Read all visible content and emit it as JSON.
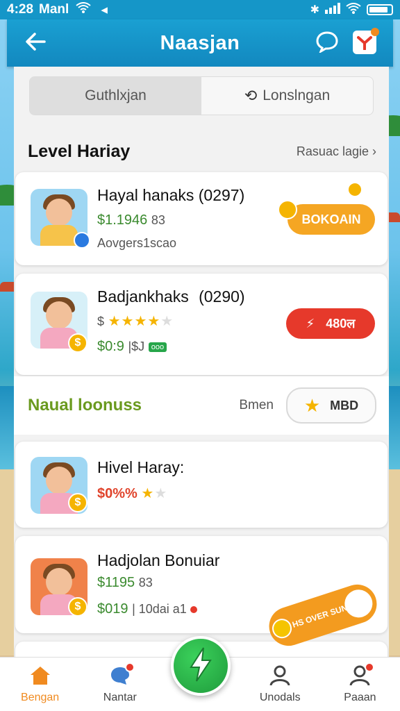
{
  "status_bar": {
    "time": "4:28",
    "carrier": "Manl"
  },
  "header": {
    "title": "Naasjan"
  },
  "segments": [
    {
      "label": "Guthlxjan"
    },
    {
      "label": "Lonslngan"
    }
  ],
  "section_level": {
    "title": "Level Hariay",
    "link": "Rasuac lagie"
  },
  "cards": [
    {
      "title": "Hayal hanaks (0297)",
      "price": "$1.1946",
      "price_suffix": "83",
      "subtitle": "Aovgers1scao",
      "button": "BOKOAIN"
    },
    {
      "title": "Badjankhaks",
      "title_code": "(0290)",
      "stars_prefix": "$",
      "price": "$0:9",
      "price_suffix": "|$J",
      "tag": "ooo",
      "button": "480ल"
    }
  ],
  "section_manual": {
    "title": "Naual loonuss",
    "link": "Bmen",
    "button": "MBD"
  },
  "cards2": [
    {
      "title": "Hivel Haray:",
      "price": "$0%%"
    },
    {
      "title": "Hadjolan Bonuiar",
      "price": "$1195",
      "price_suffix": "83",
      "price2": "$019",
      "price2_suffix": "| 10dai a1"
    }
  ],
  "promo": {
    "text": "HS OVER SUNNISE"
  },
  "bottom_nav": [
    {
      "label": "Bengan"
    },
    {
      "label": "Nantar"
    },
    {
      "label": "Unodals"
    },
    {
      "label": "Paaan"
    }
  ],
  "colors": {
    "header": "#1596c8",
    "accent_orange": "#f5a623",
    "accent_red": "#e6392b",
    "price_green": "#3a8a2e",
    "fab_green": "#27a64a"
  }
}
